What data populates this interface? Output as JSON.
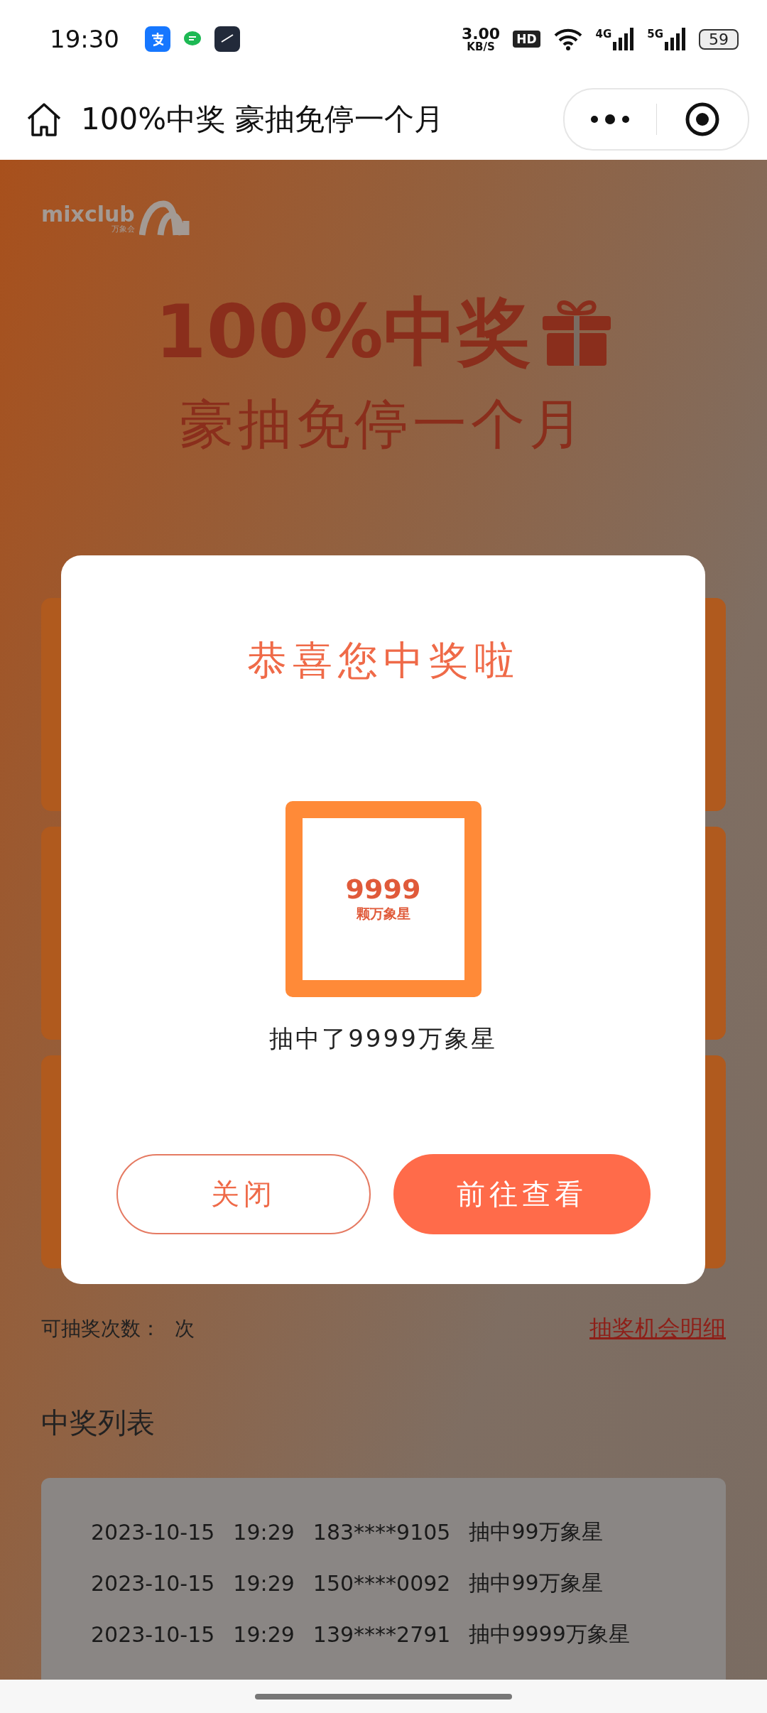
{
  "status_bar": {
    "time": "19:30",
    "speed_value": "3.00",
    "speed_unit": "KB/S",
    "hd_badge": "HD",
    "networks": [
      "4G",
      "5G"
    ],
    "battery": "59"
  },
  "nav": {
    "title": "100%中奖 豪抽免停一个月"
  },
  "hero": {
    "logo_text": "mixclub",
    "logo_subtext": "万象会",
    "headline": "100%中奖",
    "subheadline": "豪抽免停一个月"
  },
  "draw_info": {
    "label": "可抽奖次数：",
    "unit": "次",
    "link": "抽奖机会明细"
  },
  "winners": {
    "title": "中奖列表",
    "rows": [
      {
        "date": "2023-10-15",
        "time": "19:29",
        "phone": "183****9105",
        "prize": "抽中99万象星"
      },
      {
        "date": "2023-10-15",
        "time": "19:29",
        "phone": "150****0092",
        "prize": "抽中99万象星"
      },
      {
        "date": "2023-10-15",
        "time": "19:29",
        "phone": "139****2791",
        "prize": "抽中9999万象星"
      }
    ]
  },
  "modal": {
    "title": "恭喜您中奖啦",
    "prize_amount": "9999",
    "prize_unit": "颗万象星",
    "caption": "抽中了9999万象星",
    "buttons": [
      {
        "label": "关闭",
        "kind": "outline"
      },
      {
        "label": "前往查看",
        "kind": "primary"
      }
    ]
  }
}
